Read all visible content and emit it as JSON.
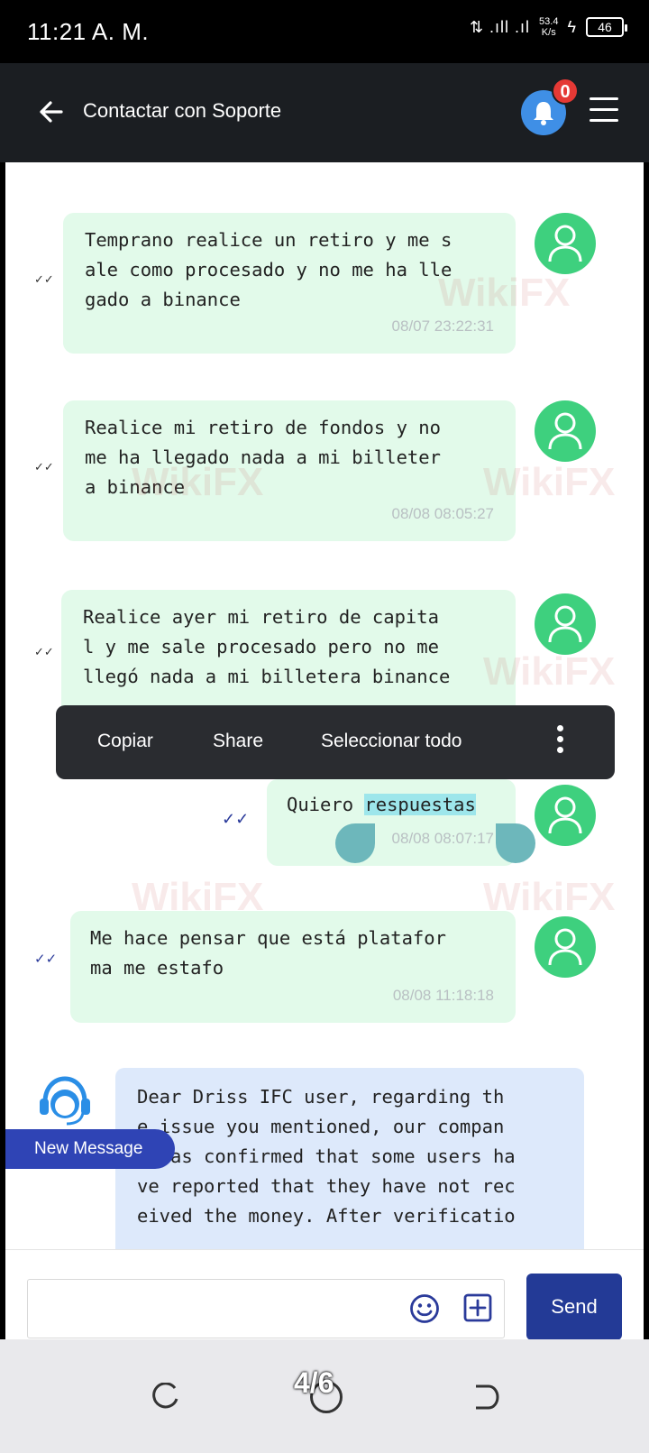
{
  "status_bar": {
    "time": "11:21 A. M.",
    "network": "4G",
    "speed": "53.4\nK/s",
    "battery": "46"
  },
  "header": {
    "title": "Contactar con Soporte",
    "notification_count": "0"
  },
  "messages": [
    {
      "text": "Temprano realice un retiro y me s\nale como procesado y no me ha lle\ngado a binance",
      "time": "08/07 23:22:31",
      "sender": "user"
    },
    {
      "text": "Realice mi retiro de fondos y no\nme ha llegado nada a mi billeter\na binance",
      "time": "08/08 08:05:27",
      "sender": "user"
    },
    {
      "text": "Realice ayer mi retiro de capita\nl y me sale procesado pero no me\nllegó nada a mi billetera binance",
      "time": "",
      "sender": "user"
    },
    {
      "text_plain": "Quiero ",
      "text_selected": "respuestas",
      "time": "08/08 08:07:17",
      "sender": "user"
    },
    {
      "text": "Me hace pensar que está platafor\nma me estafo",
      "time": "08/08 11:18:18",
      "sender": "user"
    },
    {
      "text": "Dear Driss IFC user, regarding th\ne issue you mentioned, our compan\ny has confirmed that some users ha\nve reported that they have not rec\neived the money. After verificatio",
      "time": "",
      "sender": "support"
    }
  ],
  "context_menu": {
    "copy": "Copiar",
    "share": "Share",
    "select_all": "Seleccionar todo"
  },
  "new_message_label": "New Message",
  "composer": {
    "placeholder": "",
    "send_label": "Send"
  },
  "page_indicator": "4/6",
  "watermark": "WikiFX",
  "colors": {
    "header_bg": "#1b1e22",
    "user_bubble": "#e2faea",
    "support_bubble": "#dde9fb",
    "avatar_green": "#3ed07e",
    "send_button": "#233a96",
    "badge_red": "#e53935"
  }
}
